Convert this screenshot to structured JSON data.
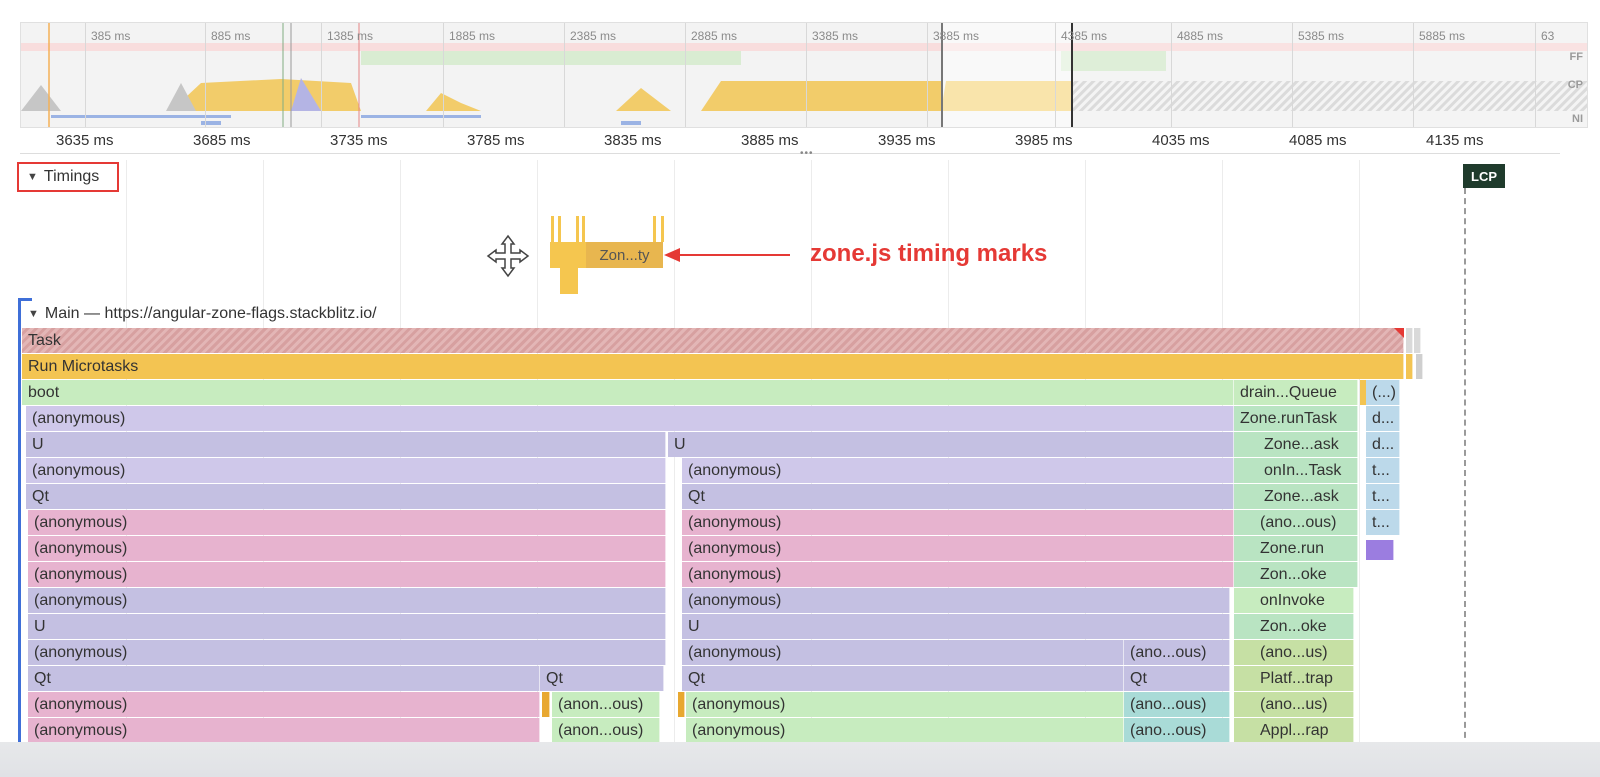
{
  "overview": {
    "ticks": [
      "385 ms",
      "885 ms",
      "1385 ms",
      "1885 ms",
      "2385 ms",
      "2885 ms",
      "3385 ms",
      "3885 ms",
      "4385 ms",
      "4885 ms",
      "5385 ms",
      "5885 ms",
      "63"
    ],
    "lanes": [
      "FF",
      "CP",
      "NI"
    ]
  },
  "ruler": {
    "ticks": [
      "3635 ms",
      "3685 ms",
      "3735 ms",
      "3785 ms",
      "3835 ms",
      "3885 ms",
      "3935 ms",
      "3985 ms",
      "4035 ms",
      "4085 ms",
      "4135 ms"
    ]
  },
  "timings": {
    "header_label": "Timings",
    "mark_label": "Zon...ty",
    "lcp_label": "LCP"
  },
  "annotation": {
    "text": "zone.js timing marks",
    "color": "#e53935"
  },
  "main": {
    "header_label": "Main — https://angular-zone-flags.stackblitz.io/"
  },
  "flame_labels": {
    "task": "Task",
    "run_microtasks": "Run Microtasks",
    "boot": "boot",
    "drain_queue": "drain...Queue",
    "paren": "(...)",
    "anonymous": "(anonymous)",
    "zone_runtask": "Zone.runTask",
    "d": "d...",
    "t": "t...",
    "u": "U",
    "zone_ask": "Zone...ask",
    "oninvoke_task": "onIn...Task",
    "qt": "Qt",
    "ano_ous": "(ano...ous)",
    "zone_run": "Zone.run",
    "zon_oke": "Zon...oke",
    "oninvoke": "onInvoke",
    "ano_us": "(ano...us)",
    "anon_ous": "(anon...ous)",
    "platf_trap": "Platf...trap",
    "appl_rap": "Appl...rap"
  },
  "colors": {
    "highlight_box": "#e53935",
    "selection_stroke": "#3f6fd8",
    "mark_yellow": "#f5c64f"
  }
}
